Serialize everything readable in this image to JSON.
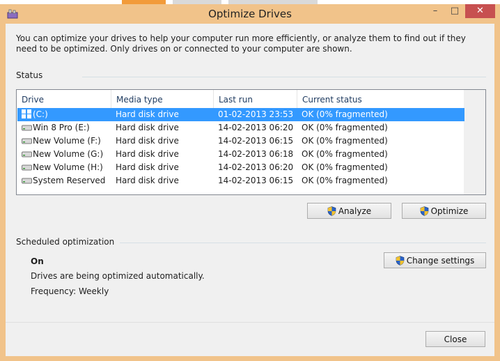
{
  "window": {
    "title": "Optimize Drives",
    "controls": {
      "minimize": "–",
      "maximize": "□",
      "close": "✕"
    }
  },
  "intro_text": "You can optimize your drives to help your computer run more efficiently, or analyze them to find out if they need to be optimized. Only drives on or connected to your computer are shown.",
  "status": {
    "heading": "Status",
    "columns": [
      "Drive",
      "Media type",
      "Last run",
      "Current status"
    ],
    "rows": [
      {
        "drive": "(C:)",
        "media": "Hard disk drive",
        "last_run": "01-02-2013 23:53",
        "status": "OK (0% fragmented)",
        "icon": "windows-drive-icon"
      },
      {
        "drive": "Win 8 Pro (E:)",
        "media": "Hard disk drive",
        "last_run": "14-02-2013 06:20",
        "status": "OK (0% fragmented)",
        "icon": "hard-drive-icon"
      },
      {
        "drive": "New Volume (F:)",
        "media": "Hard disk drive",
        "last_run": "14-02-2013 06:15",
        "status": "OK (0% fragmented)",
        "icon": "hard-drive-icon"
      },
      {
        "drive": "New Volume (G:)",
        "media": "Hard disk drive",
        "last_run": "14-02-2013 06:18",
        "status": "OK (0% fragmented)",
        "icon": "hard-drive-icon"
      },
      {
        "drive": "New Volume (H:)",
        "media": "Hard disk drive",
        "last_run": "14-02-2013 06:20",
        "status": "OK (0% fragmented)",
        "icon": "hard-drive-icon"
      },
      {
        "drive": "System Reserved",
        "media": "Hard disk drive",
        "last_run": "14-02-2013 06:15",
        "status": "OK (0% fragmented)",
        "icon": "hard-drive-icon"
      }
    ],
    "analyze_label": "Analyze",
    "optimize_label": "Optimize"
  },
  "schedule": {
    "heading": "Scheduled optimization",
    "state": "On",
    "description": "Drives are being optimized automatically.",
    "frequency": "Frequency: Weekly",
    "change_settings_label": "Change settings"
  },
  "close_label": "Close",
  "colors": {
    "frame": "#f1c38a",
    "selection": "#3399ff",
    "close_button": "#c75050"
  }
}
